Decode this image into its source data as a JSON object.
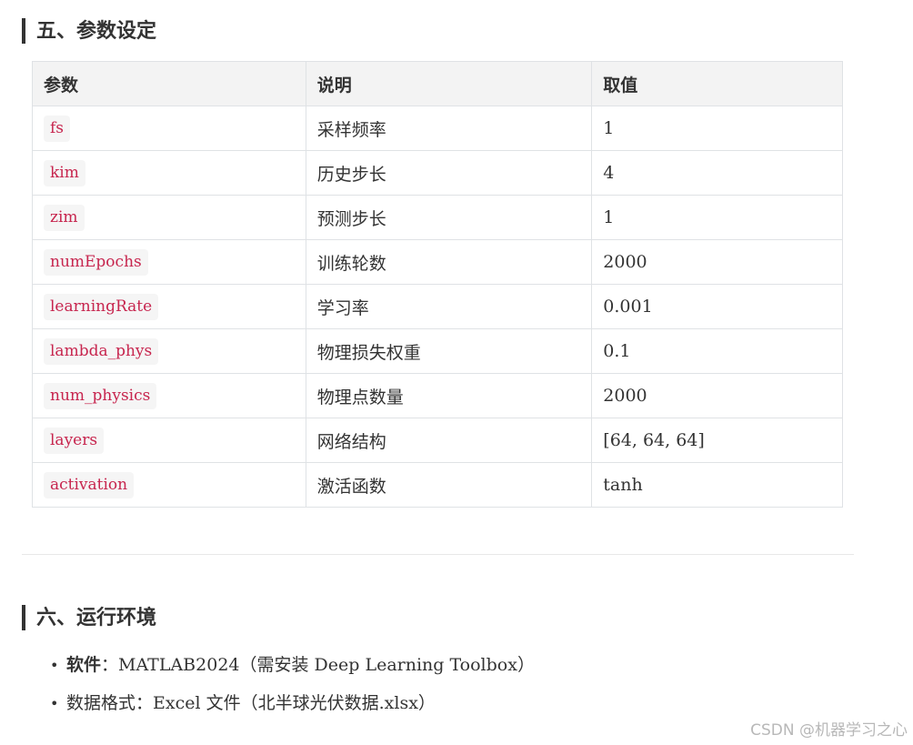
{
  "section5": {
    "heading": "五、参数设定",
    "table": {
      "headers": [
        "参数",
        "说明",
        "取值"
      ],
      "rows": [
        {
          "param": "fs",
          "desc": "采样频率",
          "value": "1"
        },
        {
          "param": "kim",
          "desc": "历史步长",
          "value": "4"
        },
        {
          "param": "zim",
          "desc": "预测步长",
          "value": "1"
        },
        {
          "param": "numEpochs",
          "desc": "训练轮数",
          "value": "2000"
        },
        {
          "param": "learningRate",
          "desc": "学习率",
          "value": "0.001"
        },
        {
          "param": "lambda_phys",
          "desc": "物理损失权重",
          "value": "0.1"
        },
        {
          "param": "num_physics",
          "desc": "物理点数量",
          "value": "2000"
        },
        {
          "param": "layers",
          "desc": "网络结构",
          "value": "[64, 64, 64]"
        },
        {
          "param": "activation",
          "desc": "激活函数",
          "value": "tanh"
        }
      ]
    }
  },
  "section6": {
    "heading": "六、运行环境",
    "items": [
      {
        "bullet": "•",
        "label": "软件",
        "sep": "：",
        "text": "MATLAB2024（需安装 Deep Learning Toolbox）"
      },
      {
        "bullet": "•",
        "label": "数据格式",
        "sep": "：",
        "text": "Excel 文件（北半球光伏数据.xlsx）"
      }
    ]
  },
  "watermark": "CSDN @机器学习之心",
  "colors": {
    "code_text": "#c7254e",
    "code_bg": "#f5f5f5",
    "header_bg": "#f3f3f3",
    "border": "#dfe2e5"
  }
}
